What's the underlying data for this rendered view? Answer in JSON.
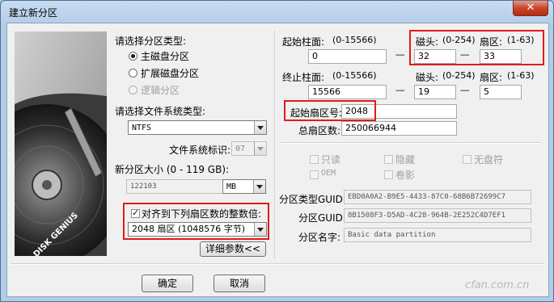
{
  "window": {
    "title": "建立新分区",
    "close_glyph": "✕"
  },
  "partition_type": {
    "label": "请选择分区类型:",
    "options": [
      {
        "label": "主磁盘分区",
        "selected": true,
        "enabled": true
      },
      {
        "label": "扩展磁盘分区",
        "selected": false,
        "enabled": true
      },
      {
        "label": "逻辑分区",
        "selected": false,
        "enabled": false
      }
    ]
  },
  "filesystem": {
    "label": "请选择文件系统类型:",
    "value": "NTFS",
    "id_label": "文件系统标识:",
    "id_value": "07"
  },
  "size": {
    "label": "新分区大小 (0 - 119 GB):",
    "value": "122103",
    "unit": "MB"
  },
  "align": {
    "checkbox_label": "对齐到下列扇区数的整数倍:",
    "value": "2048 扇区 (1048576 字节)",
    "details_button": "详细参数<<"
  },
  "start": {
    "cyl_label": "起始柱面:",
    "cyl_range": "(0-15566)",
    "cyl_value": "0",
    "head_label": "磁头:",
    "head_range": "(0-254)",
    "head_value": "32",
    "sector_label": "扇区:",
    "sector_range": "(1-63)",
    "sector_value": "33",
    "sep": "----"
  },
  "end": {
    "cyl_label": "终止柱面:",
    "cyl_range": "(0-15566)",
    "cyl_value": "15566",
    "head_label": "磁头:",
    "head_range": "(0-254)",
    "head_value": "19",
    "sector_label": "扇区:",
    "sector_range": "(1-63)",
    "sector_value": "5"
  },
  "lba": {
    "start_label": "起始扇区号:",
    "start_value": "2048",
    "total_label": "总扇区数:",
    "total_value": "250066944"
  },
  "attributes": {
    "readonly": "只读",
    "hidden": "隐藏",
    "no_letter": "无盘符",
    "oem": "OEM",
    "shadow": "卷影"
  },
  "gpt": {
    "type_guid_label": "分区类型GUID:",
    "type_guid_value": "EBD0A0A2-B9E5-4433-87C0-68B6B72699C7",
    "guid_label": "分区GUID:",
    "guid_value": "8B1508F3-D5AD-4C28-964B-2E252C4D7EF1",
    "name_label": "分区名字:",
    "name_value": "Basic data partition"
  },
  "buttons": {
    "ok": "确定",
    "cancel": "取消"
  },
  "art": {
    "disk_brand": "DISK GENIUS"
  },
  "watermark": "cfan.com.cn"
}
